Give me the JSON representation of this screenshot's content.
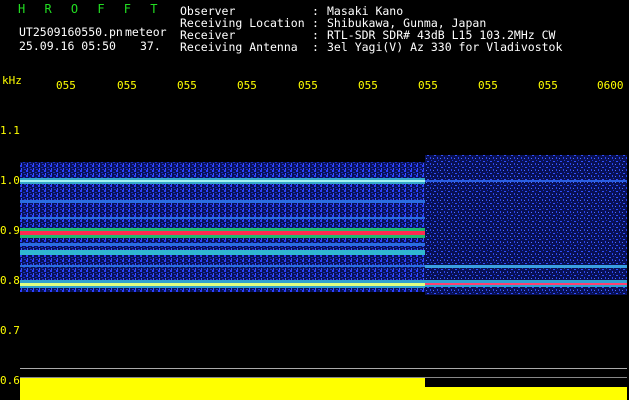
{
  "header": {
    "brand": "H R O F F T",
    "file_name": "UT2509160550.pn",
    "tag": "meteor",
    "date_time": "25.09.16 05:50",
    "count": "37.",
    "info": [
      {
        "label": "Observer",
        "sep": ":",
        "value": "Masaki Kano"
      },
      {
        "label": "Receiving Location",
        "sep": ":",
        "value": "Shibukawa, Gunma, Japan"
      },
      {
        "label": "Receiver",
        "sep": ":",
        "value": "RTL-SDR SDR# 43dB L15 103.2MHz CW"
      },
      {
        "label": "Receiving Antenna",
        "sep": ":",
        "value": "3el Yagi(V) Az 330 for Vladivostok"
      }
    ]
  },
  "axis": {
    "unit": "kHz",
    "y_ticks": [
      "1.1",
      "1.0",
      "0.9",
      "0.8",
      "0.7",
      "0.6"
    ],
    "x_ticks": [
      "055",
      "055",
      "055",
      "055",
      "055",
      "055",
      "055",
      "055",
      "055",
      "0600"
    ]
  },
  "colors": {
    "label_green": "#22dd22",
    "text_white": "#ffffff",
    "signal_yellow": "#ffff00",
    "spectrum_blue": "#1a2ad8",
    "band_red": "#ff2244"
  }
}
